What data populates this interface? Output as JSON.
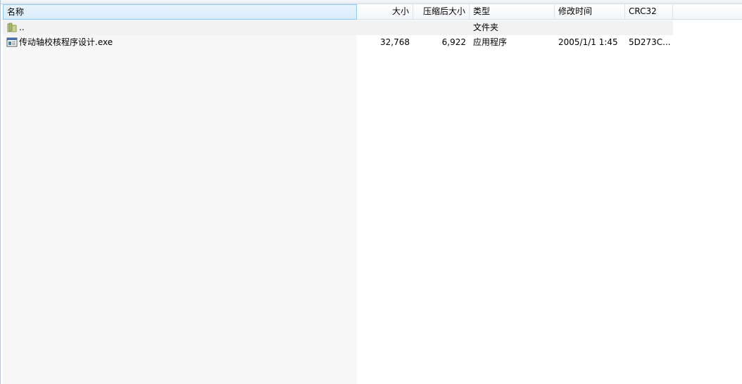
{
  "columns": {
    "name": "名称",
    "size": "大小",
    "packed": "压缩后大小",
    "type": "类型",
    "modified": "修改时间",
    "crc": "CRC32"
  },
  "sort_indicator": "ˆ",
  "rows": [
    {
      "icon": "folder-icon",
      "name": "..",
      "size": "",
      "packed": "",
      "type": "文件夹",
      "modified": "",
      "crc": ""
    },
    {
      "icon": "exe-file-icon",
      "name": "传动轴校核程序设计.exe",
      "size": "32,768",
      "packed": "6,922",
      "type": "应用程序",
      "modified": "2005/1/1 1:45",
      "crc": "5D273C..."
    }
  ],
  "colors": {
    "sorted_header_bg": "#d9ecfb",
    "sorted_header_border": "#91c9f7",
    "name_column_bg": "#f7f7f7",
    "alt_row_bg": "#f2f2f2"
  }
}
